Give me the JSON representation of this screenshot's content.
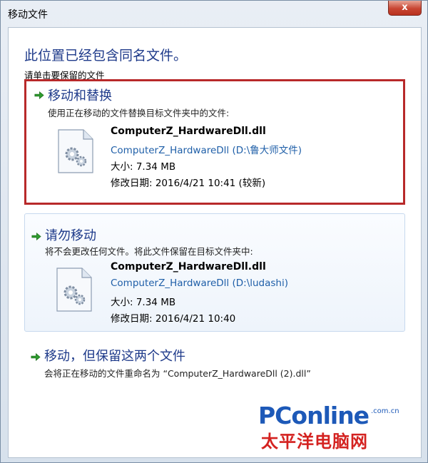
{
  "window": {
    "title": "移动文件",
    "close_label": "x"
  },
  "dialog": {
    "heading": "此位置已经包含同名文件。",
    "subheading": "请单击要保留的文件"
  },
  "options": {
    "replace": {
      "title": "移动和替换",
      "desc": "使用正在移动的文件替换目标文件夹中的文件:",
      "file_name": "ComputerZ_HardwareDll.dll",
      "file_path": "ComputerZ_HardwareDll (D:\\鲁大师文件)",
      "file_size": "大小: 7.34 MB",
      "file_date": "修改日期: 2016/4/21 10:41 (较新)"
    },
    "skip": {
      "title": "请勿移动",
      "desc": "将不会更改任何文件。将此文件保留在目标文件夹中:",
      "file_name": "ComputerZ_HardwareDll.dll",
      "file_path": "ComputerZ_HardwareDll (D:\\ludashi)",
      "file_size": "大小: 7.34 MB",
      "file_date": "修改日期: 2016/4/21 10:40"
    },
    "keep_both": {
      "title": "移动，但保留这两个文件",
      "desc": "会将正在移动的文件重命名为 “ComputerZ_HardwareDll (2).dll”"
    }
  },
  "watermark": {
    "brand": "PConline",
    "domain": ".com.cn",
    "cn_name": "太平洋电脑网"
  },
  "colors": {
    "accent_blue": "#1e3a8a",
    "arrow_green": "#2f9e2f",
    "highlight_red": "#b8292a"
  }
}
